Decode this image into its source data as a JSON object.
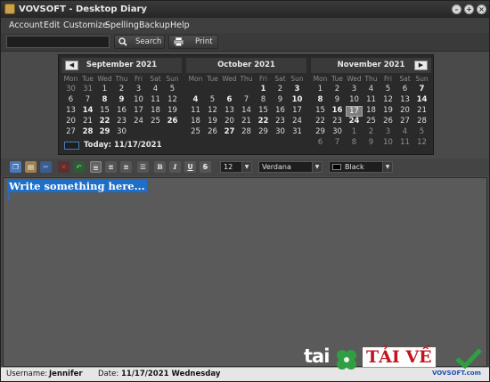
{
  "window": {
    "title": "VOVSOFT - Desktop Diary"
  },
  "menu": [
    "Account",
    "Edit",
    "Customize",
    "Spelling",
    "Backup",
    "Help"
  ],
  "toolbar": {
    "search_value": "",
    "search_label": "Search",
    "print_label": "Print"
  },
  "calendar": {
    "weekdays": [
      "Mon",
      "Tue",
      "Wed",
      "Thu",
      "Fri",
      "Sat",
      "Sun"
    ],
    "months": [
      {
        "title": "September 2021",
        "nav": "left",
        "days": [
          [
            "30",
            "31",
            "1",
            "2",
            "3",
            "4",
            "5"
          ],
          [
            "6",
            "7",
            "8",
            "9",
            "10",
            "11",
            "12"
          ],
          [
            "13",
            "14",
            "15",
            "16",
            "17",
            "18",
            "19"
          ],
          [
            "20",
            "21",
            "22",
            "23",
            "24",
            "25",
            "26"
          ],
          [
            "27",
            "28",
            "29",
            "30",
            "",
            "",
            ""
          ]
        ]
      },
      {
        "title": "October 2021",
        "nav": "",
        "days": [
          [
            "",
            "",
            "",
            "",
            "1",
            "2",
            "3"
          ],
          [
            "4",
            "5",
            "6",
            "7",
            "8",
            "9",
            "10"
          ],
          [
            "11",
            "12",
            "13",
            "14",
            "15",
            "16",
            "17"
          ],
          [
            "18",
            "19",
            "20",
            "21",
            "22",
            "23",
            "24"
          ],
          [
            "25",
            "26",
            "27",
            "28",
            "29",
            "30",
            "31"
          ]
        ]
      },
      {
        "title": "November 2021",
        "nav": "right",
        "days": [
          [
            "1",
            "2",
            "3",
            "4",
            "5",
            "6",
            "7"
          ],
          [
            "8",
            "9",
            "10",
            "11",
            "12",
            "13",
            "14"
          ],
          [
            "15",
            "16",
            "17",
            "18",
            "19",
            "20",
            "21"
          ],
          [
            "22",
            "23",
            "24",
            "25",
            "26",
            "27",
            "28"
          ],
          [
            "29",
            "30",
            "1",
            "2",
            "3",
            "4",
            "5"
          ],
          [
            "6",
            "7",
            "8",
            "9",
            "10",
            "11",
            "12"
          ]
        ]
      }
    ],
    "today_label": "Today: 11/17/2021"
  },
  "format": {
    "font_size": "12",
    "font_name": "Verdana",
    "color_name": "Black",
    "color_swatch": "#000000"
  },
  "editor": {
    "text": "Write something here..."
  },
  "status": {
    "username_label": "Username:",
    "username": "Jennifer",
    "date_label": "Date:",
    "date": "11/17/2021 Wednesday"
  },
  "watermark": {
    "brand": "tai",
    "text": "TẢI VỀ",
    "footer": "VOVSOFT.com"
  },
  "colors": {
    "accent": "#1e6ec8",
    "background": "#4a4a4a",
    "watermark_red": "#c0151f",
    "watermark_green": "#2ea043"
  },
  "icons": [
    "app-icon",
    "minimize-icon",
    "maximize-icon",
    "close-icon",
    "search-icon",
    "printer-icon",
    "copy-icon",
    "paste-icon",
    "cut-icon",
    "delete-icon",
    "undo-icon",
    "align-left-icon",
    "align-center-icon",
    "align-right-icon",
    "bullet-list-icon",
    "bold-icon",
    "italic-icon",
    "underline-icon",
    "strikethrough-icon",
    "clover-icon",
    "checkmark-icon"
  ]
}
